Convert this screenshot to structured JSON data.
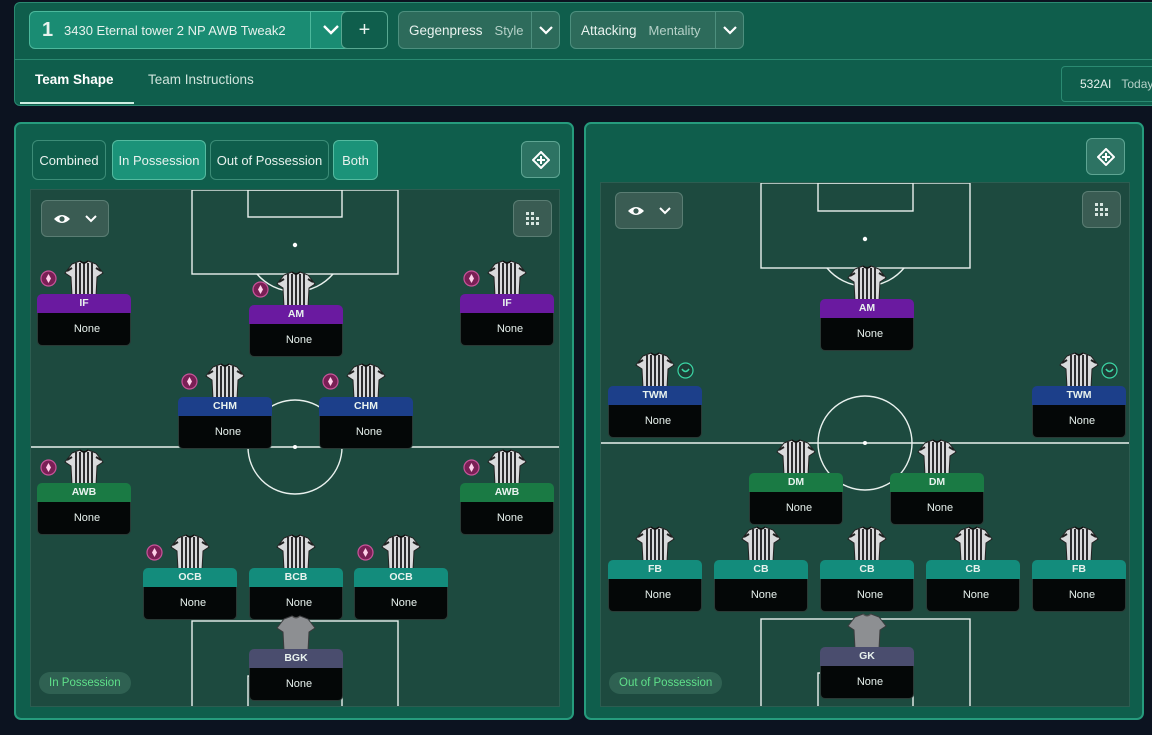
{
  "tactic": {
    "number": "1",
    "name": "3430 Eternal tower 2 NP AWB Tweak2",
    "add_label": "+"
  },
  "style": {
    "value": "Gegenpress",
    "label": "Style"
  },
  "mentality": {
    "value": "Attacking",
    "label": "Mentality"
  },
  "tabs": [
    {
      "label": "Team Shape"
    },
    {
      "label": "Team Instructions"
    }
  ],
  "right_info": {
    "code": "532AI",
    "label": "Today"
  },
  "left_panel": {
    "segments": [
      {
        "label": "Combined",
        "active": false
      },
      {
        "label": "In Possession",
        "active": true
      },
      {
        "label": "Out of Possession",
        "active": false
      },
      {
        "label": "Both",
        "active": true
      }
    ],
    "badge": "In Possession",
    "players": [
      {
        "role": "IF",
        "name": "None",
        "color": "#6a1aa0",
        "icon": "instruction-icon-pink"
      },
      {
        "role": "AM",
        "name": "None",
        "color": "#6a1aa0",
        "icon": "instruction-icon-pink"
      },
      {
        "role": "IF",
        "name": "None",
        "color": "#6a1aa0",
        "icon": "instruction-icon-pink"
      },
      {
        "role": "CHM",
        "name": "None",
        "color": "#1c3f8a",
        "icon": "instruction-icon-pink"
      },
      {
        "role": "CHM",
        "name": "None",
        "color": "#1c3f8a",
        "icon": "instruction-icon-pink"
      },
      {
        "role": "AWB",
        "name": "None",
        "color": "#1a7a44",
        "icon": "instruction-icon-pink"
      },
      {
        "role": "AWB",
        "name": "None",
        "color": "#1a7a44",
        "icon": "instruction-icon-pink"
      },
      {
        "role": "OCB",
        "name": "None",
        "color": "#138c7c",
        "icon": "instruction-icon-pink"
      },
      {
        "role": "BCB",
        "name": "None",
        "color": "#138c7c",
        "icon": ""
      },
      {
        "role": "OCB",
        "name": "None",
        "color": "#138c7c",
        "icon": "instruction-icon-pink"
      },
      {
        "role": "BGK",
        "name": "None",
        "color": "#4a4d6e",
        "icon": ""
      }
    ]
  },
  "right_panel": {
    "badge": "Out of Possession",
    "players": [
      {
        "role": "AM",
        "name": "None",
        "color": "#6a1aa0",
        "icon": ""
      },
      {
        "role": "TWM",
        "name": "None",
        "color": "#1c3f8a",
        "icon": "instruction-icon-green"
      },
      {
        "role": "TWM",
        "name": "None",
        "color": "#1c3f8a",
        "icon": "instruction-icon-green"
      },
      {
        "role": "DM",
        "name": "None",
        "color": "#1a7a44",
        "icon": ""
      },
      {
        "role": "DM",
        "name": "None",
        "color": "#1a7a44",
        "icon": ""
      },
      {
        "role": "FB",
        "name": "None",
        "color": "#138c7c",
        "icon": ""
      },
      {
        "role": "CB",
        "name": "None",
        "color": "#138c7c",
        "icon": ""
      },
      {
        "role": "CB",
        "name": "None",
        "color": "#138c7c",
        "icon": ""
      },
      {
        "role": "CB",
        "name": "None",
        "color": "#138c7c",
        "icon": ""
      },
      {
        "role": "FB",
        "name": "None",
        "color": "#138c7c",
        "icon": ""
      },
      {
        "role": "GK",
        "name": "None",
        "color": "#4a4d6e",
        "icon": ""
      }
    ]
  }
}
